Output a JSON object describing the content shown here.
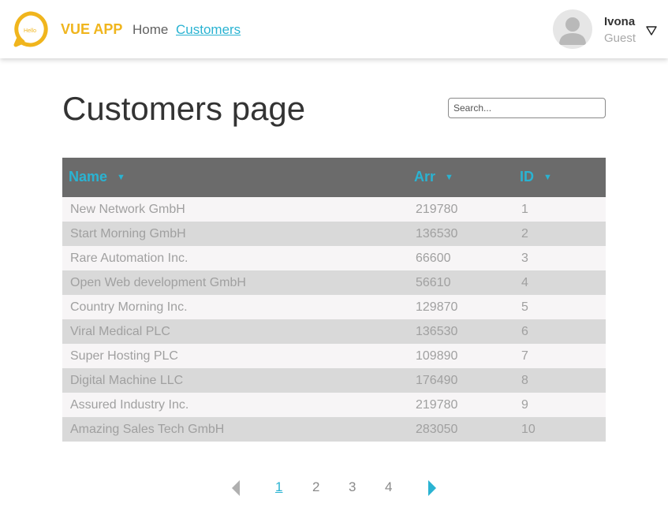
{
  "header": {
    "logo_text": "Hello",
    "brand": "VUE APP",
    "nav": [
      {
        "label": "Home"
      },
      {
        "label": "Customers"
      }
    ],
    "user": {
      "name": "Ivona",
      "role": "Guest"
    }
  },
  "page": {
    "title": "Customers page",
    "search_placeholder": "Search..."
  },
  "table": {
    "columns": [
      {
        "label": "Name",
        "caret": "▼"
      },
      {
        "label": "Arr",
        "caret": "▼"
      },
      {
        "label": "ID",
        "caret": "▼"
      }
    ],
    "rows": [
      {
        "name": "New Network GmbH",
        "arr": "219780",
        "id": "1"
      },
      {
        "name": "Start Morning GmbH",
        "arr": "136530",
        "id": "2"
      },
      {
        "name": "Rare Automation Inc.",
        "arr": "66600",
        "id": "3"
      },
      {
        "name": "Open Web development GmbH",
        "arr": "56610",
        "id": "4"
      },
      {
        "name": "Country Morning Inc.",
        "arr": "129870",
        "id": "5"
      },
      {
        "name": "Viral Medical PLC",
        "arr": "136530",
        "id": "6"
      },
      {
        "name": "Super Hosting PLC",
        "arr": "109890",
        "id": "7"
      },
      {
        "name": "Digital Machine LLC",
        "arr": "176490",
        "id": "8"
      },
      {
        "name": "Assured Industry Inc.",
        "arr": "219780",
        "id": "9"
      },
      {
        "name": "Amazing Sales Tech GmbH",
        "arr": "283050",
        "id": "10"
      }
    ]
  },
  "pagination": {
    "pages": [
      "1",
      "2",
      "3",
      "4"
    ],
    "current": "1"
  },
  "colors": {
    "brand": "#f0b51d",
    "accent": "#2ab3d2",
    "header_bg": "#6b6b6b",
    "row_light": "#f7f5f6",
    "row_dark": "#d9d9d9"
  }
}
